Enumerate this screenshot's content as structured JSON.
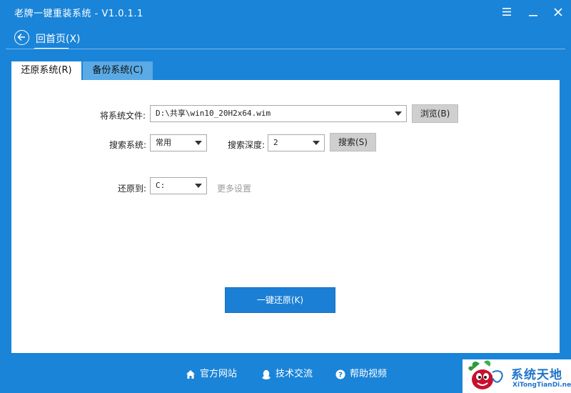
{
  "window": {
    "title": "老牌一键重装系统 - V1.0.1.1"
  },
  "back": {
    "label": "回首页(X)"
  },
  "tabs": [
    {
      "label": "还原系统(R)",
      "active": true
    },
    {
      "label": "备份系统(C)",
      "active": false
    }
  ],
  "form": {
    "file_label": "将系统文件:",
    "file_value": "D:\\共享\\win10_20H2x64.wim",
    "browse_label": "浏览(B)",
    "search_system_label": "搜索系统:",
    "search_system_value": "常用",
    "search_depth_label": "搜索深度:",
    "search_depth_value": "2",
    "search_button_label": "搜索(S)",
    "restore_to_label": "还原到:",
    "restore_to_value": "C:",
    "more_settings_label": "更多设置",
    "restore_button_label": "一键还原(K)"
  },
  "footer": {
    "links": [
      {
        "label": "官方网站",
        "icon": "home-icon"
      },
      {
        "label": "技术交流",
        "icon": "qq-penguin-icon"
      },
      {
        "label": "帮助视频",
        "icon": "help-icon"
      }
    ]
  },
  "watermark": {
    "name_cn": "系统天地",
    "name_en": "XiTongTianDi.net"
  },
  "colors": {
    "background": "#1a84d8",
    "primary_button": "#1b7fd6",
    "inactive_tab": "#5aaae6",
    "logo_text": "#1f74c9"
  }
}
